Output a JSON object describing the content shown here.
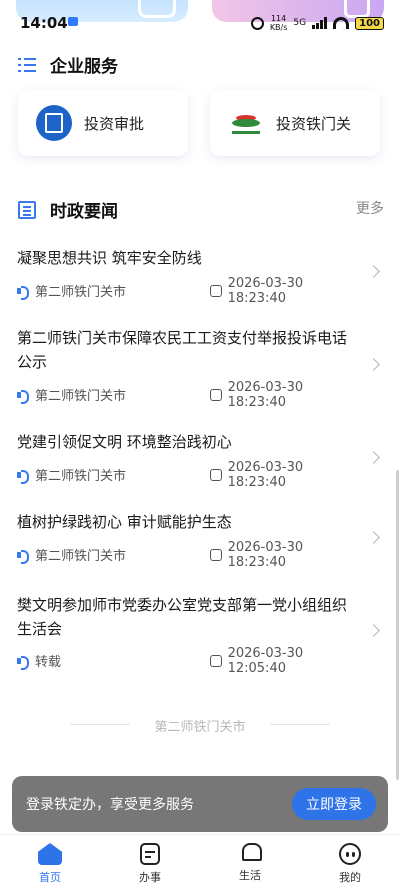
{
  "status_bar": {
    "time": "14:04",
    "net_speed_value": "114",
    "net_speed_unit": "KB/s",
    "network": "5G",
    "battery": "100"
  },
  "enterprise": {
    "title": "企业服务",
    "cards": [
      {
        "label": "投资审批",
        "icon": "investment-approval-icon"
      },
      {
        "label": "投资铁门关",
        "icon": "tiemenguan-logo-icon"
      }
    ]
  },
  "news_section": {
    "title": "时政要闻",
    "more_label": "更多",
    "items": [
      {
        "title": "凝聚思想共识 筑牢安全防线",
        "source": "第二师铁门关市",
        "datetime": "2026-03-30 18:23:40"
      },
      {
        "title": "第二师铁门关市保障农民工工资支付举报投诉电话公示",
        "source": "第二师铁门关市",
        "datetime": "2026-03-30 18:23:40"
      },
      {
        "title": "党建引领促文明 环境整治践初心",
        "source": "第二师铁门关市",
        "datetime": "2026-03-30 18:23:40"
      },
      {
        "title": "植树护绿践初心 审计赋能护生态",
        "source": "第二师铁门关市",
        "datetime": "2026-03-30 18:23:40"
      },
      {
        "title": "樊文明参加师市党委办公室党支部第一党小组组织生活会",
        "source": "转载",
        "datetime": "2026-03-30 12:05:40"
      }
    ]
  },
  "footer_note": "第二师铁门关市",
  "login_bar": {
    "text": "登录铁定办，享受更多服务",
    "button": "立即登录"
  },
  "tabbar": [
    {
      "label": "首页",
      "active": true
    },
    {
      "label": "办事",
      "active": false
    },
    {
      "label": "生活",
      "active": false
    },
    {
      "label": "我的",
      "active": false
    }
  ],
  "colors": {
    "accent": "#2f73e9",
    "icon_blue": "#3a78f2"
  }
}
